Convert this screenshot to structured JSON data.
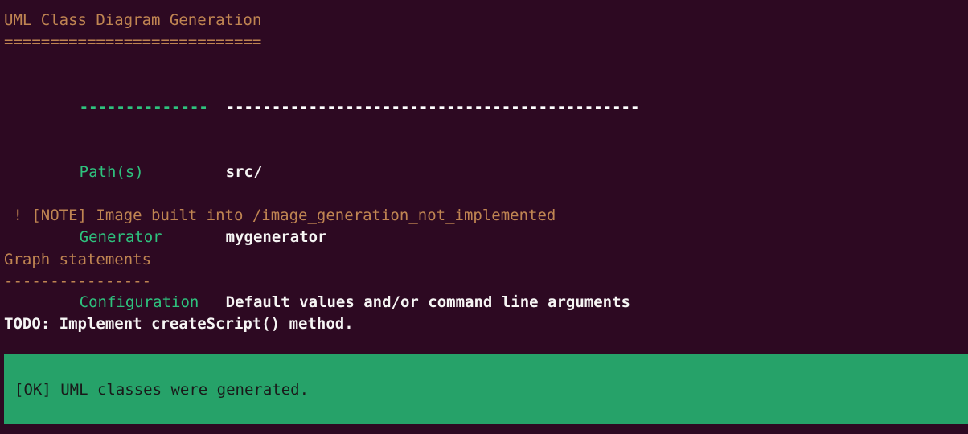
{
  "terminal": {
    "background_color": "#2d0922",
    "accent_tan": "#c08552",
    "accent_green": "#2ec27e",
    "banner_green": "#26a269",
    "text_white": "#f6f5f4"
  },
  "header": {
    "title": "UML Class Diagram Generation",
    "underline": "============================"
  },
  "info_table": {
    "top_rule_left": "--------------",
    "top_rule_right": "---------------------------------------------",
    "bottom_rule_left": "--------------",
    "bottom_rule_right": "---------------------------------------------",
    "rows": [
      {
        "label": "Path(s)",
        "value": "src/"
      },
      {
        "label": "Generator",
        "value": "mygenerator"
      },
      {
        "label": "Configuration",
        "value": "Default values and/or command line arguments"
      }
    ]
  },
  "note": {
    "marker": "!",
    "tag": "[NOTE]",
    "text": "Image built into /image_generation_not_implemented",
    "full_line": " ! [NOTE] Image built into /image_generation_not_implemented"
  },
  "graph_section": {
    "title": "Graph statements",
    "underline": "----------------",
    "body": "TODO: Implement createScript() method."
  },
  "status_banner": {
    "tag": "[OK]",
    "message": "UML classes were generated.",
    "full_line": "[OK] UML classes were generated."
  }
}
